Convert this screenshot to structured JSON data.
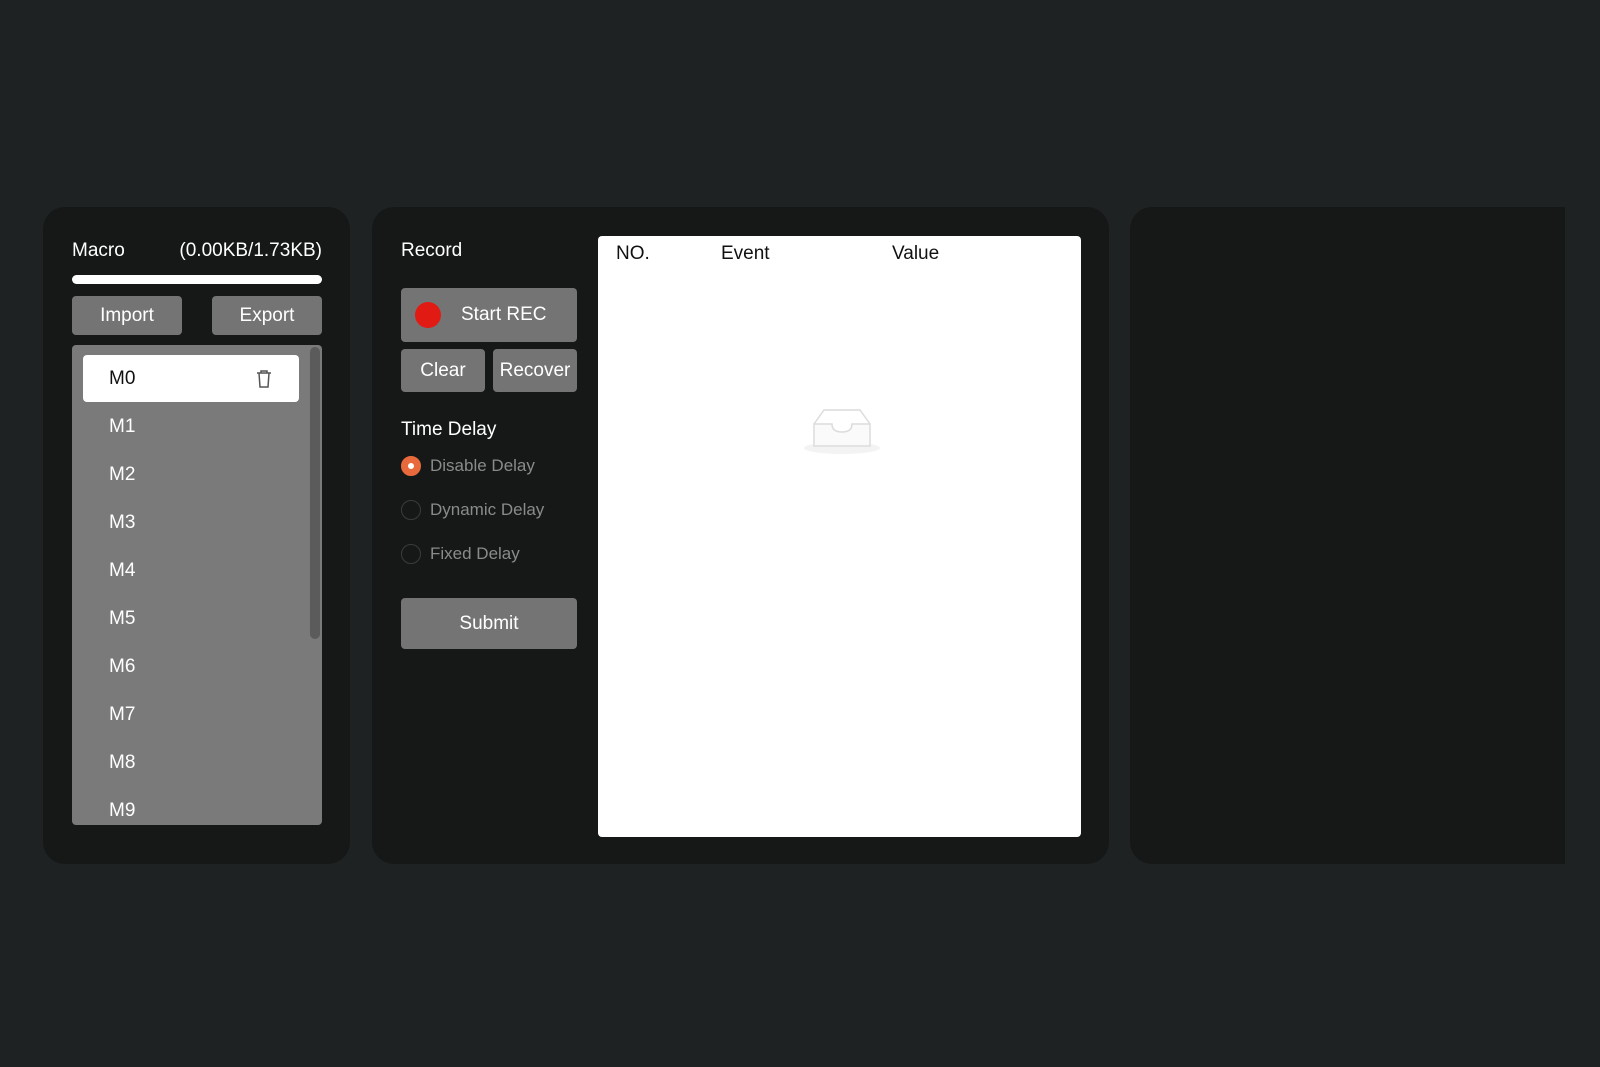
{
  "macro": {
    "title": "Macro",
    "usage": "(0.00KB/1.73KB)",
    "usage_fraction": 0.0,
    "import_label": "Import",
    "export_label": "Export",
    "items": [
      "M0",
      "M1",
      "M2",
      "M3",
      "M4",
      "M5",
      "M6",
      "M7",
      "M8",
      "M9"
    ],
    "selected": "M0"
  },
  "record": {
    "title": "Record",
    "start_label": "Start REC",
    "clear_label": "Clear",
    "recover_label": "Recover",
    "delay_title": "Time Delay",
    "delay_options": [
      "Disable Delay",
      "Dynamic Delay",
      "Fixed Delay"
    ],
    "delay_selected": "Disable Delay",
    "submit_label": "Submit"
  },
  "table": {
    "columns": [
      "NO.",
      "Event",
      "Value"
    ]
  },
  "colors": {
    "accent": "#e86a3c",
    "rec": "#e11a14",
    "panel": "#161818",
    "background": "#1f2223"
  }
}
